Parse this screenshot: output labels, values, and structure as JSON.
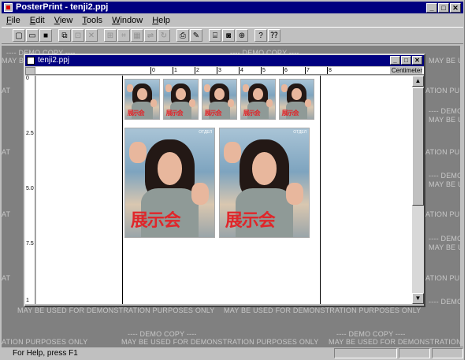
{
  "app": {
    "title": "PosterPrint - tenji2.ppj"
  },
  "menu": [
    {
      "label": "File"
    },
    {
      "label": "Edit"
    },
    {
      "label": "View"
    },
    {
      "label": "Tools"
    },
    {
      "label": "Window"
    },
    {
      "label": "Help"
    }
  ],
  "toolbar": {
    "buttons": [
      {
        "name": "new-icon",
        "glyph": "▢"
      },
      {
        "name": "open-icon",
        "glyph": "▭"
      },
      {
        "name": "save-icon",
        "glyph": "■"
      },
      {
        "name": "sep"
      },
      {
        "name": "copy-icon",
        "glyph": "⧉"
      },
      {
        "name": "paste-icon",
        "glyph": "⊡",
        "dim": true
      },
      {
        "name": "delete-icon",
        "glyph": "✕",
        "dim": true
      },
      {
        "name": "sep"
      },
      {
        "name": "crop-icon",
        "glyph": "⊞",
        "dim": true
      },
      {
        "name": "crop2-icon",
        "glyph": "⌗",
        "dim": true
      },
      {
        "name": "grid-icon",
        "glyph": "▦",
        "dim": true
      },
      {
        "name": "flip-icon",
        "glyph": "⇌",
        "dim": true
      },
      {
        "name": "rotate-icon",
        "glyph": "↻",
        "dim": true
      },
      {
        "name": "sep"
      },
      {
        "name": "print-icon",
        "glyph": "⎙"
      },
      {
        "name": "tool-icon",
        "glyph": "✎"
      },
      {
        "name": "sep"
      },
      {
        "name": "scan-icon",
        "glyph": "⌸"
      },
      {
        "name": "camera-icon",
        "glyph": "◙"
      },
      {
        "name": "insert-icon",
        "glyph": "⊕"
      },
      {
        "name": "sep"
      },
      {
        "name": "help-icon",
        "glyph": "?"
      },
      {
        "name": "context-help-icon",
        "glyph": "⁇"
      }
    ]
  },
  "watermark": {
    "line1": "---- DEMO COPY ----",
    "line2": "MAY BE USED FOR DEMONSTRATION PURPOSES ONLY",
    "line2_prefix": "MAY BE U",
    "line2_suffix": "ATION PURPOSES ONLY",
    "line2_short": "AT"
  },
  "document": {
    "title": "tenji2.ppj",
    "unit": "Centimeter",
    "hruler": [
      "0",
      "1",
      "2",
      "3",
      "4",
      "5",
      "6",
      "7",
      "8"
    ],
    "vruler": [
      "0",
      "2.5",
      "5.0",
      "7.5",
      "1"
    ]
  },
  "poster": {
    "caption": "展示会",
    "tag": "ОТДЕЛ"
  },
  "status": {
    "text": "For Help, press F1"
  }
}
